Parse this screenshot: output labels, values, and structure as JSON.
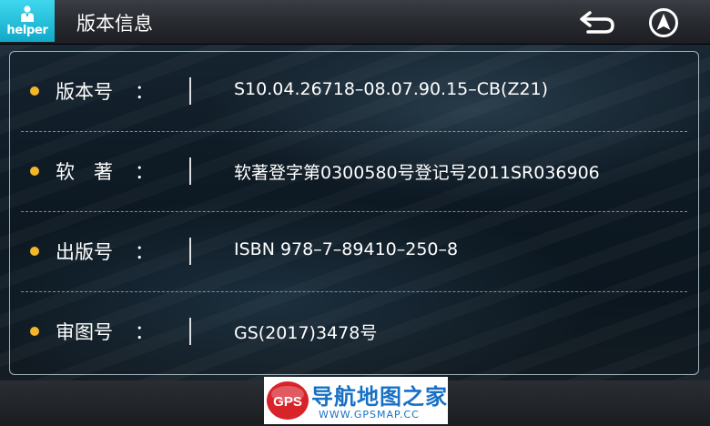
{
  "header": {
    "logo_text": "helper",
    "title": "版本信息"
  },
  "info_rows": [
    {
      "key": "版本号",
      "colon": "：",
      "value": "S10.04.26718–08.07.90.15–CB(Z21)"
    },
    {
      "key": "软　著",
      "colon": "：",
      "value": "软著登字第0300580号登记号2011SR036906"
    },
    {
      "key": "出版号",
      "colon": "：",
      "value": "ISBN 978–7–89410–250–8"
    },
    {
      "key": "审图号",
      "colon": "：",
      "value": "GS(2017)3478号"
    }
  ],
  "watermark": {
    "badge_text": "GPS",
    "site_name": "导航地图之家",
    "url": "WWW.GPSMAP.CC"
  },
  "colors": {
    "accent_logo": "#1fb8d8",
    "bullet": "#f3b62a",
    "watermark_red": "#d8232a",
    "watermark_blue": "#1770c4"
  },
  "icons": {
    "back": "return-arrow-icon",
    "navigate": "navigation-arrow-icon"
  }
}
